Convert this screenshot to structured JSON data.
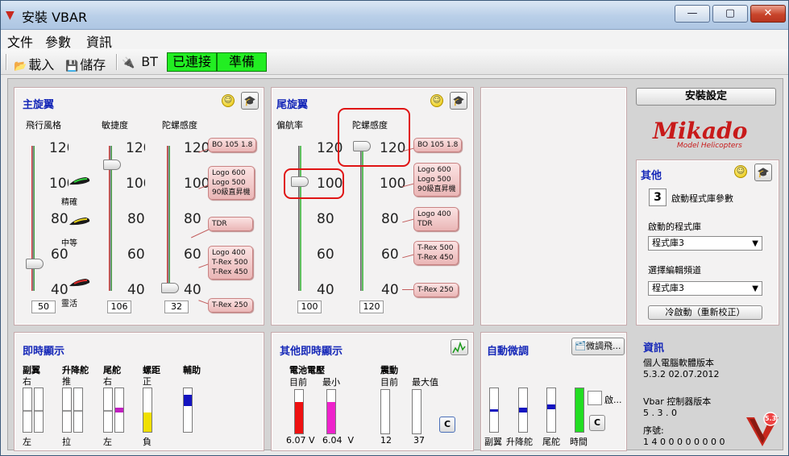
{
  "window": {
    "title": "安裝 VBAR",
    "min_symbol": "—",
    "max_symbol": "▢",
    "close_symbol": "✕"
  },
  "menu": [
    "文件",
    "參數",
    "資訊"
  ],
  "toolbar": {
    "load": "載入",
    "save": "儲存",
    "bt": "BT",
    "connected": "已連接",
    "ready": "準備"
  },
  "main_rotor": {
    "title": "主旋翼",
    "col1": "飛行風格",
    "col2": "敏捷度",
    "col3": "陀螺感度",
    "scale": [
      "120",
      "100",
      "80",
      "60",
      "40"
    ],
    "style_labels": {
      "precise": "精確",
      "medium": "中等",
      "agile": "靈活"
    },
    "values": {
      "style": "50",
      "agility": "106",
      "gyro": "32"
    },
    "thumb_levels": {
      "style": 0.17,
      "agility": 0.87,
      "gyro": 0.0
    },
    "tags": [
      {
        "lines": [
          "BO 105 1.8"
        ]
      },
      {
        "lines": [
          "Logo 600",
          "Logo 500",
          "90級直昇機"
        ]
      },
      {
        "lines": [
          "TDR"
        ]
      },
      {
        "lines": [
          "Logo 400",
          "T-Rex 500",
          "T-Rex 450"
        ]
      },
      {
        "lines": [
          "T-Rex 250"
        ]
      }
    ]
  },
  "tail_rotor": {
    "title": "尾旋翼",
    "col1": "偏航率",
    "col2": "陀螺感度",
    "scale": [
      "120",
      "100",
      "80",
      "60",
      "40"
    ],
    "values": {
      "yaw": "100",
      "gyro": "120"
    },
    "thumb_levels": {
      "yaw": 0.75,
      "gyro": 1.0
    },
    "tags": [
      {
        "lines": [
          "BO 105 1.8"
        ]
      },
      {
        "lines": [
          "Logo 600",
          "Logo 500",
          "90級直昇機"
        ]
      },
      {
        "lines": [
          "Logo 400",
          "TDR"
        ]
      },
      {
        "lines": [
          "T-Rex 500",
          "T-Rex 450"
        ]
      },
      {
        "lines": [
          "T-Rex 250"
        ]
      }
    ]
  },
  "setup": {
    "button": "安裝設定",
    "logo": "Mikado",
    "logo_sub": "Model Helicopters"
  },
  "other": {
    "title": "其他",
    "count": "3",
    "count_label": "啟動程式庫參數",
    "active_label": "啟動的程式庫",
    "active_value": "程式庫3",
    "edit_label": "選擇編輯頻道",
    "edit_value": "程式庫3",
    "cold_start": "冷啟動（重新校正）"
  },
  "live": {
    "title": "即時顯示",
    "channels": [
      {
        "name": "副翼",
        "top": "右",
        "bottom": "左"
      },
      {
        "name": "升降舵",
        "top": "推",
        "bottom": "拉"
      },
      {
        "name": "尾舵",
        "top": "右",
        "bottom": "左"
      },
      {
        "name": "螺距",
        "top": "正",
        "bottom": "負"
      },
      {
        "name": "輔助",
        "top": "",
        "bottom": ""
      }
    ],
    "colors": {
      "rudder": "#c020c0",
      "pitch": "#f0e000",
      "aux": "#1414c0"
    },
    "levels": {
      "rudder": 0.5,
      "pitch": 0.45,
      "aux": 0.72
    }
  },
  "other_live": {
    "title": "其他即時顯示",
    "battery": "電池電壓",
    "current": "目前",
    "min": "最小",
    "vibration": "震動",
    "vib_current": "目前",
    "vib_max": "最大值",
    "battery_current": "6.07",
    "battery_min": "6.04",
    "unit": "V",
    "vib_current_value": "12",
    "vib_max_value": "37",
    "reset": "C",
    "colors": {
      "battery": "#ee1111",
      "battery_min": "#ee22cc"
    },
    "levels": {
      "battery": 0.73,
      "battery_min": 0.73,
      "vib": 0.0,
      "vib_max": 0.0
    }
  },
  "auto_trim": {
    "title": "自動微調",
    "fine_button": "微調飛...",
    "enable": "啟...",
    "reset": "C",
    "channels": [
      "副翼",
      "升降舵",
      "尾舵",
      "時間"
    ],
    "colors": {
      "marker": "#1414c0",
      "time": "#22dd22"
    },
    "levels": {
      "aileron": 0.5,
      "elevator": 0.5,
      "rudder": 0.58,
      "time": 1.0
    }
  },
  "info": {
    "title": "資訊",
    "pc_label": "個人電腦軟體版本",
    "pc_version": "5.3.2  02.07.2012",
    "vbar_label": "Vbar 控制器版本",
    "vbar_version": "5 . 3 . 0",
    "serial_label": "序號:",
    "serial": "1 4 0 0 0 0 0 0 0 0",
    "badge": "5.3"
  }
}
